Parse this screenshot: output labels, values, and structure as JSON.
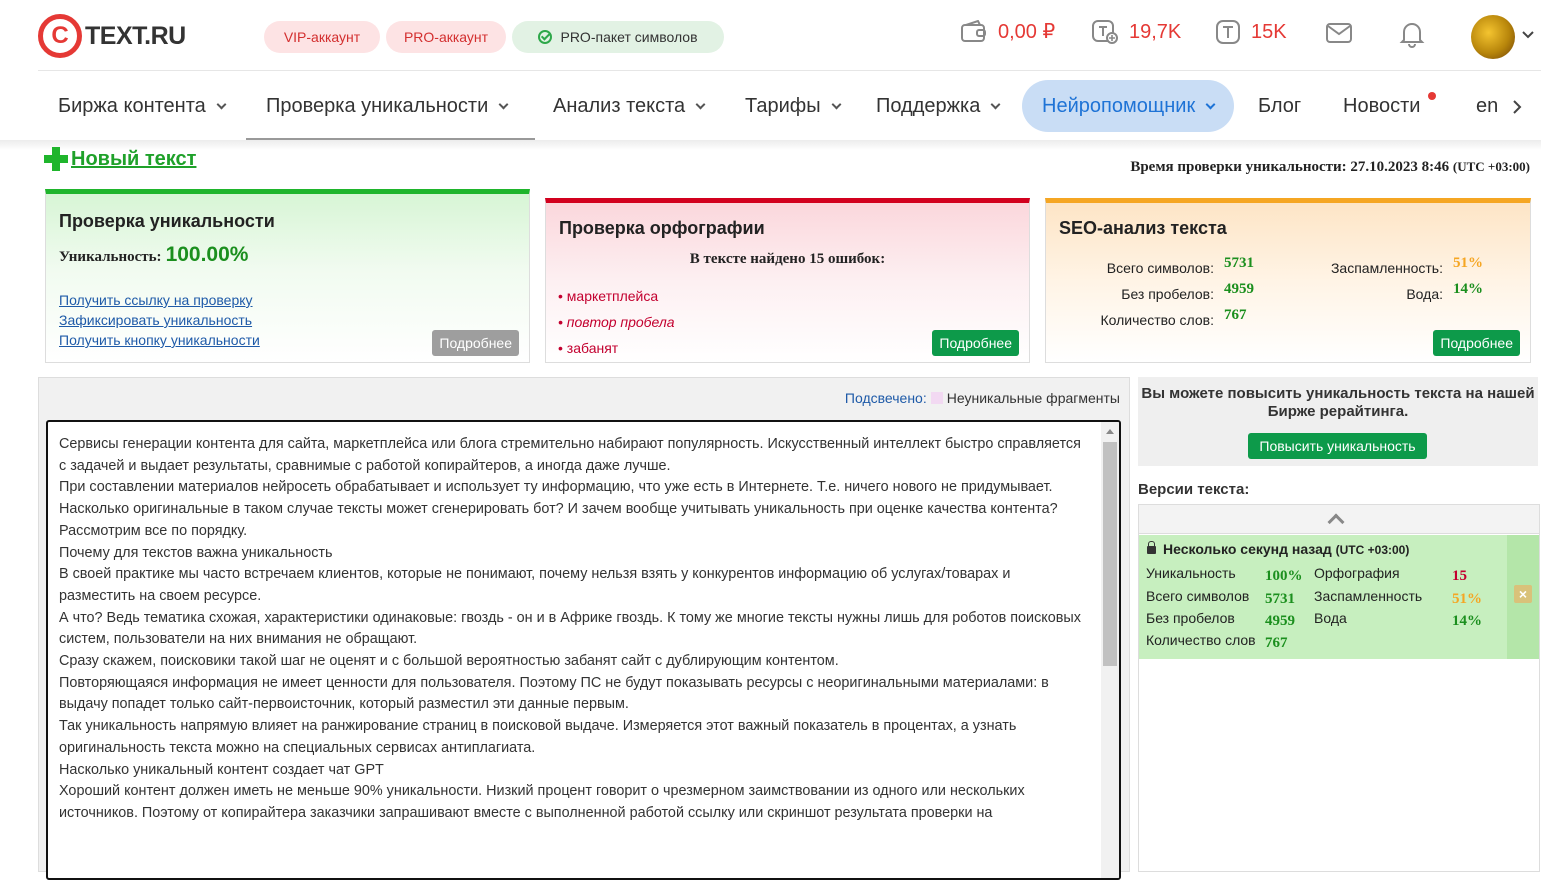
{
  "header": {
    "logo_text": "TEXT.RU",
    "logo_mark": "C",
    "badges": {
      "vip": "VIP-аккаунт",
      "pro": "PRO-аккаунт",
      "package": "PRO-пакет символов"
    },
    "wallet": "0,00 ₽",
    "chars": "19,7K",
    "tokens": "15K",
    "icons": [
      "wallet-icon",
      "add-chars-icon",
      "token-icon",
      "mail-icon",
      "bell-icon"
    ]
  },
  "nav": {
    "items": [
      "Биржа контента",
      "Проверка уникальности",
      "Анализ текста",
      "Тарифы",
      "Поддержка",
      "Нейропомощник",
      "Блог",
      "Новости",
      "en"
    ]
  },
  "toolbar": {
    "new_text": "Новый текст",
    "check_time_label": "Время проверки уникальности: 27.10.2023 8:46",
    "check_time_tz": "(UTC +03:00)"
  },
  "uniq_card": {
    "title": "Проверка уникальности",
    "label": "Уникальность:",
    "value": "100.00%",
    "links": [
      "Получить ссылку на проверку",
      "Зафиксировать уникальность",
      "Получить кнопку уникальности"
    ],
    "more": "Подробнее"
  },
  "spell_card": {
    "title": "Проверка орфографии",
    "subtitle": "В тексте найдено 15 ошибок:",
    "errors": [
      "маркетплейса",
      "повтор пробела",
      "забанят"
    ],
    "more": "Подробнее"
  },
  "seo_card": {
    "title": "SEO-анализ текста",
    "total_label": "Всего символов:",
    "total": "5731",
    "nospace_label": "Без пробелов:",
    "nospace": "4959",
    "words_label": "Количество слов:",
    "words": "767",
    "spam_label": "Заспамленность:",
    "spam": "51%",
    "water_label": "Вода:",
    "water": "14%",
    "more": "Подробнее"
  },
  "editor": {
    "highlight_label": "Подсвечено:",
    "highlight_legend": "Неуникальные фрагменты",
    "paragraphs": [
      "Сервисы генерации контента для сайта, маркетплейса или блога стремительно набирают популярность. Искусственный интеллект быстро справляется с задачей и выдает результаты, сравнимые с работой копирайтеров, а иногда даже лучше.",
      "При составлении материалов нейросеть обрабатывает и использует ту информацию, что уже есть в Интернете. Т.е. ничего нового не придумывает.",
      "Насколько оригинальные  в таком случае тексты может сгенерировать бот? И зачем вообще учитывать уникальность при оценке качества контента?",
      "Рассмотрим все по порядку.",
      "Почему для текстов важна уникальность",
      "В своей практике мы часто встречаем клиентов, которые не понимают, почему нельзя  взять у конкурентов информацию об услугах/товарах и разместить на своем ресурсе.",
      "А что? Ведь тематика схожая, характеристики одинаковые: гвоздь - он и в Африке гвоздь. К тому же многие тексты нужны лишь для роботов поисковых систем, пользователи на них внимания не обращают.",
      "Сразу скажем, поисковики такой шаг не оценят и с большой вероятностью забанят сайт с дублирующим контентом.",
      "Повторяющаяся информация не имеет ценности для пользователя. Поэтому ПС не будут показывать ресурсы с неоригинальными материалами: в выдачу попадет только сайт-первоисточник, который разместил эти данные первым.",
      "Так уникальность напрямую влияет на ранжирование страниц в поисковой выдаче. Измеряется этот важный показатель в процентах, а узнать оригинальность текста  можно на специальных сервисах антиплагиата.",
      "Насколько уникальный контент создает чат GPT",
      "Хороший контент должен иметь не меньше 90% уникальности. Низкий процент говорит о чрезмерном заимствовании из одного или нескольких источников. Поэтому от копирайтера заказчики запрашивают вместе с выполненной работой ссылку или скриншот результата проверки на"
    ]
  },
  "promo": {
    "text": "Вы можете повысить уникальность текста на нашей Бирже рерайтинга.",
    "button": "Повысить уникальность"
  },
  "versions": {
    "title": "Версии текста:",
    "item": {
      "time": "Несколько секунд назад",
      "tz": "(UTC +03:00)",
      "uniq_label": "Уникальность",
      "uniq": "100%",
      "total_label": "Всего символов",
      "total": "5731",
      "nospace_label": "Без пробелов",
      "nospace": "4959",
      "words_label": "Количество слов",
      "words": "767",
      "spell_label": "Орфография",
      "spell": "15",
      "spam_label": "Заспамленность",
      "spam": "51%",
      "water_label": "Вода",
      "water": "14%"
    }
  },
  "colors": {
    "brand_red": "#e53935",
    "accent_green": "#1fb52c",
    "button_green": "#0d9a4a",
    "neuro_blue": "#1e73d6"
  }
}
